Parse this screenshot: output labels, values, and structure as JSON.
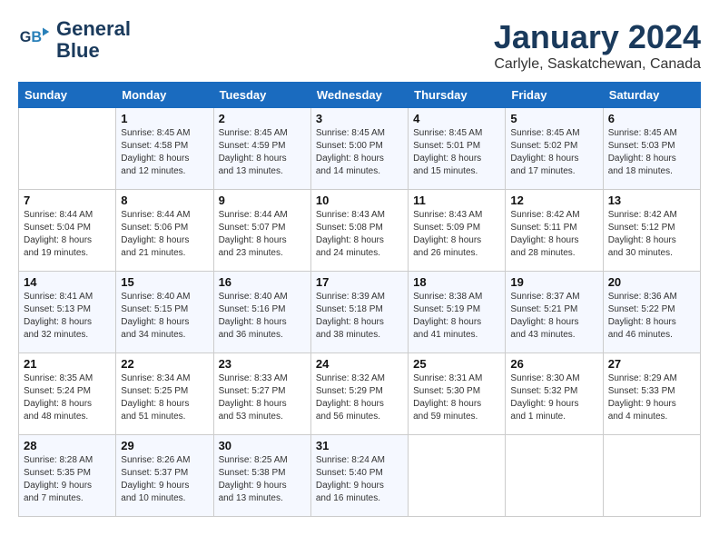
{
  "header": {
    "logo_line1": "General",
    "logo_line2": "Blue",
    "title": "January 2024",
    "subtitle": "Carlyle, Saskatchewan, Canada"
  },
  "days_of_week": [
    "Sunday",
    "Monday",
    "Tuesday",
    "Wednesday",
    "Thursday",
    "Friday",
    "Saturday"
  ],
  "weeks": [
    [
      {
        "day": "",
        "info": ""
      },
      {
        "day": "1",
        "info": "Sunrise: 8:45 AM\nSunset: 4:58 PM\nDaylight: 8 hours\nand 12 minutes."
      },
      {
        "day": "2",
        "info": "Sunrise: 8:45 AM\nSunset: 4:59 PM\nDaylight: 8 hours\nand 13 minutes."
      },
      {
        "day": "3",
        "info": "Sunrise: 8:45 AM\nSunset: 5:00 PM\nDaylight: 8 hours\nand 14 minutes."
      },
      {
        "day": "4",
        "info": "Sunrise: 8:45 AM\nSunset: 5:01 PM\nDaylight: 8 hours\nand 15 minutes."
      },
      {
        "day": "5",
        "info": "Sunrise: 8:45 AM\nSunset: 5:02 PM\nDaylight: 8 hours\nand 17 minutes."
      },
      {
        "day": "6",
        "info": "Sunrise: 8:45 AM\nSunset: 5:03 PM\nDaylight: 8 hours\nand 18 minutes."
      }
    ],
    [
      {
        "day": "7",
        "info": "Sunrise: 8:44 AM\nSunset: 5:04 PM\nDaylight: 8 hours\nand 19 minutes."
      },
      {
        "day": "8",
        "info": "Sunrise: 8:44 AM\nSunset: 5:06 PM\nDaylight: 8 hours\nand 21 minutes."
      },
      {
        "day": "9",
        "info": "Sunrise: 8:44 AM\nSunset: 5:07 PM\nDaylight: 8 hours\nand 23 minutes."
      },
      {
        "day": "10",
        "info": "Sunrise: 8:43 AM\nSunset: 5:08 PM\nDaylight: 8 hours\nand 24 minutes."
      },
      {
        "day": "11",
        "info": "Sunrise: 8:43 AM\nSunset: 5:09 PM\nDaylight: 8 hours\nand 26 minutes."
      },
      {
        "day": "12",
        "info": "Sunrise: 8:42 AM\nSunset: 5:11 PM\nDaylight: 8 hours\nand 28 minutes."
      },
      {
        "day": "13",
        "info": "Sunrise: 8:42 AM\nSunset: 5:12 PM\nDaylight: 8 hours\nand 30 minutes."
      }
    ],
    [
      {
        "day": "14",
        "info": "Sunrise: 8:41 AM\nSunset: 5:13 PM\nDaylight: 8 hours\nand 32 minutes."
      },
      {
        "day": "15",
        "info": "Sunrise: 8:40 AM\nSunset: 5:15 PM\nDaylight: 8 hours\nand 34 minutes."
      },
      {
        "day": "16",
        "info": "Sunrise: 8:40 AM\nSunset: 5:16 PM\nDaylight: 8 hours\nand 36 minutes."
      },
      {
        "day": "17",
        "info": "Sunrise: 8:39 AM\nSunset: 5:18 PM\nDaylight: 8 hours\nand 38 minutes."
      },
      {
        "day": "18",
        "info": "Sunrise: 8:38 AM\nSunset: 5:19 PM\nDaylight: 8 hours\nand 41 minutes."
      },
      {
        "day": "19",
        "info": "Sunrise: 8:37 AM\nSunset: 5:21 PM\nDaylight: 8 hours\nand 43 minutes."
      },
      {
        "day": "20",
        "info": "Sunrise: 8:36 AM\nSunset: 5:22 PM\nDaylight: 8 hours\nand 46 minutes."
      }
    ],
    [
      {
        "day": "21",
        "info": "Sunrise: 8:35 AM\nSunset: 5:24 PM\nDaylight: 8 hours\nand 48 minutes."
      },
      {
        "day": "22",
        "info": "Sunrise: 8:34 AM\nSunset: 5:25 PM\nDaylight: 8 hours\nand 51 minutes."
      },
      {
        "day": "23",
        "info": "Sunrise: 8:33 AM\nSunset: 5:27 PM\nDaylight: 8 hours\nand 53 minutes."
      },
      {
        "day": "24",
        "info": "Sunrise: 8:32 AM\nSunset: 5:29 PM\nDaylight: 8 hours\nand 56 minutes."
      },
      {
        "day": "25",
        "info": "Sunrise: 8:31 AM\nSunset: 5:30 PM\nDaylight: 8 hours\nand 59 minutes."
      },
      {
        "day": "26",
        "info": "Sunrise: 8:30 AM\nSunset: 5:32 PM\nDaylight: 9 hours\nand 1 minute."
      },
      {
        "day": "27",
        "info": "Sunrise: 8:29 AM\nSunset: 5:33 PM\nDaylight: 9 hours\nand 4 minutes."
      }
    ],
    [
      {
        "day": "28",
        "info": "Sunrise: 8:28 AM\nSunset: 5:35 PM\nDaylight: 9 hours\nand 7 minutes."
      },
      {
        "day": "29",
        "info": "Sunrise: 8:26 AM\nSunset: 5:37 PM\nDaylight: 9 hours\nand 10 minutes."
      },
      {
        "day": "30",
        "info": "Sunrise: 8:25 AM\nSunset: 5:38 PM\nDaylight: 9 hours\nand 13 minutes."
      },
      {
        "day": "31",
        "info": "Sunrise: 8:24 AM\nSunset: 5:40 PM\nDaylight: 9 hours\nand 16 minutes."
      },
      {
        "day": "",
        "info": ""
      },
      {
        "day": "",
        "info": ""
      },
      {
        "day": "",
        "info": ""
      }
    ]
  ]
}
